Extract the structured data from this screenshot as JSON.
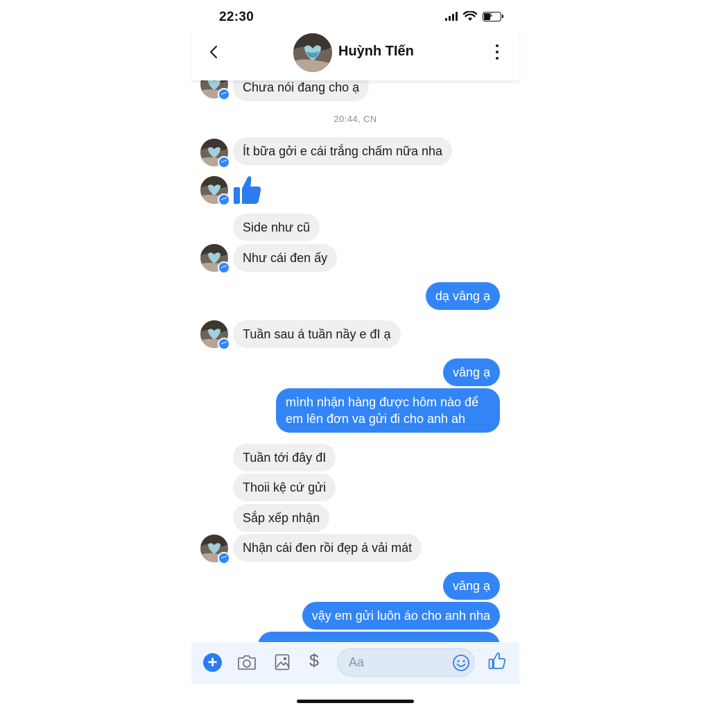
{
  "status_bar": {
    "time": "22:30"
  },
  "header": {
    "contact_name": "Huỳnh TIến"
  },
  "messages": {
    "m0": "Chưa nói đang cho ạ",
    "timestamp": "20:44, CN",
    "m1": "Ít bữa gởi e cái trắng chấm nữa nha",
    "m2": "Side như cũ",
    "m3": "Như cái đen ấy",
    "m4": "dạ vâng ạ",
    "m5": "Tuần sau á tuần nầy e đI ạ",
    "m6": "vâng ạ",
    "m7": "mình nhận hàng được hôm nào để em lên đơn va gửi đi cho anh ah",
    "m8": "Tuần tới đây đI",
    "m9": "Thoii kệ cứ gửi",
    "m10": "Sắp xếp nhận",
    "m11": "Nhận cái đen rồi đẹp á vải mát",
    "m12": "vâng ạ",
    "m13": "vậy em gửi luôn áo cho anh nha"
  },
  "composer": {
    "placeholder": "Aa",
    "currency_symbol": "$",
    "plus_label": "+"
  },
  "colors": {
    "accent": "#3385f5",
    "incoming_bubble": "#efefef",
    "composer_bg": "#eef5ff"
  }
}
